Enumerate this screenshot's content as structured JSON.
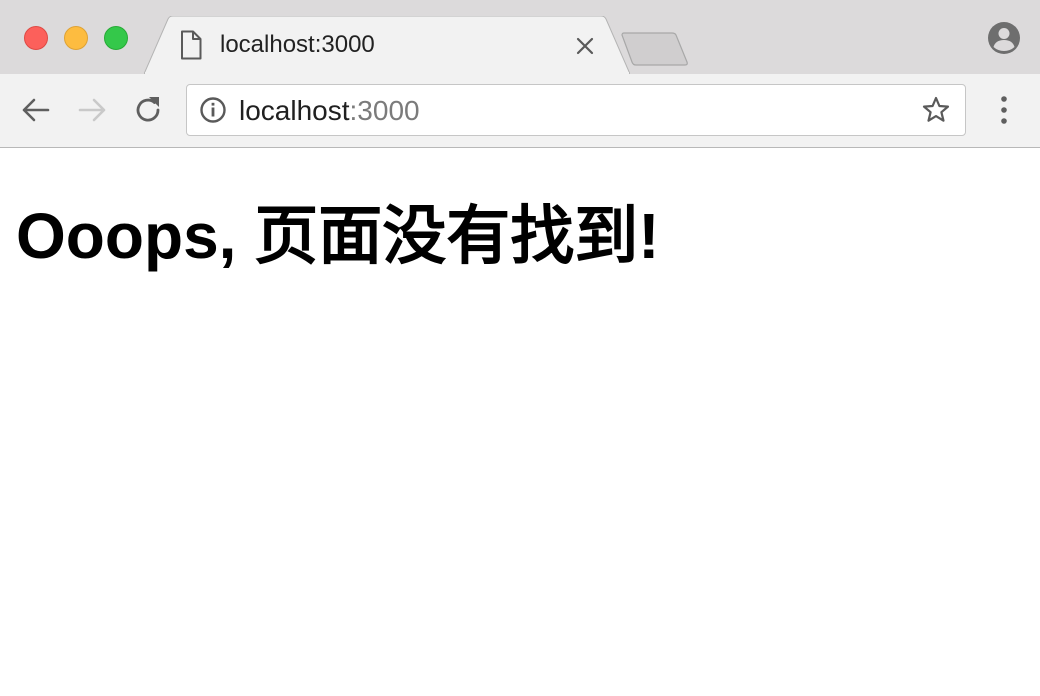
{
  "browser": {
    "tab": {
      "title": "localhost:3000",
      "favicon": "document-icon"
    },
    "address_bar": {
      "host": "localhost",
      "port": ":3000"
    },
    "colors": {
      "close_button": "#fc605b",
      "minimize_button": "#fdbc40",
      "maximize_button": "#34c84a",
      "tabstrip_background": "#dcdadb",
      "toolbar_background": "#f2f2f2",
      "port_text": "#7b7b7b"
    },
    "icons": {
      "back": "back-arrow-icon",
      "forward": "forward-arrow-icon",
      "reload": "reload-icon",
      "info": "info-icon",
      "bookmark": "star-icon",
      "menu": "kebab-menu-icon",
      "profile": "profile-icon",
      "tab_close": "close-icon"
    }
  },
  "page": {
    "heading": "Ooops, 页面没有找到!"
  }
}
